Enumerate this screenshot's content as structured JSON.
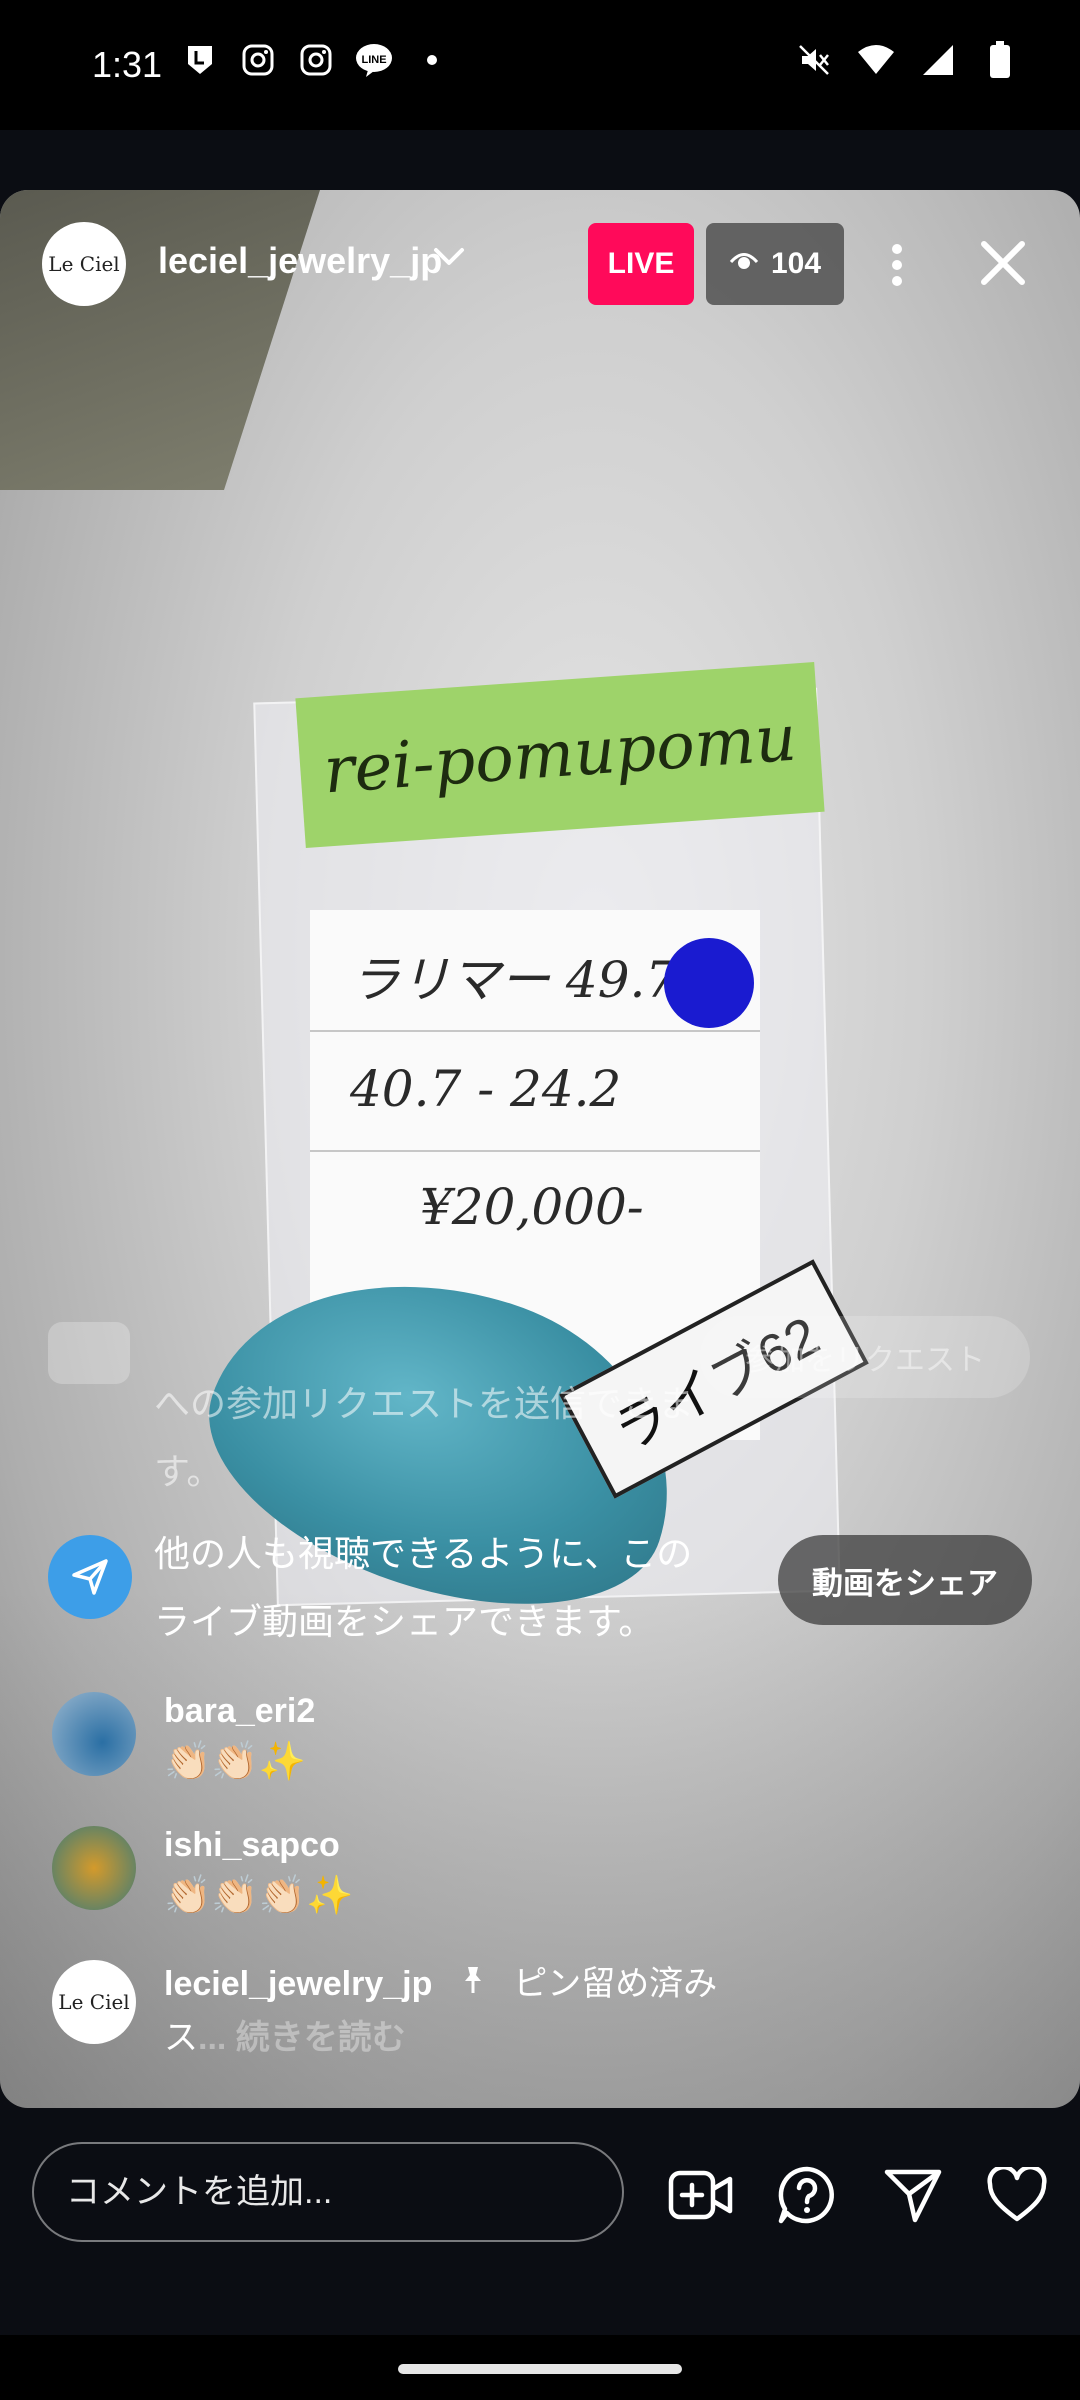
{
  "status_bar": {
    "time": "1:31",
    "app_icons": [
      "l-app-icon",
      "instagram-icon",
      "instagram-icon",
      "line-icon",
      "dot-icon"
    ],
    "system_icons": [
      "mute-icon",
      "wifi-icon",
      "signal-icon",
      "battery-icon"
    ]
  },
  "header": {
    "avatar_text": "Le Ciel",
    "username": "leciel_jewelry_jp",
    "live_label": "LIVE",
    "viewer_count": "104"
  },
  "video": {
    "sticky_note": "rei-pomupomu",
    "card_line1": "ラリマー 49.71",
    "card_line2": "40.7 - 24.2",
    "card_line3": "¥20,000-",
    "tag_text": "ライブ62"
  },
  "overlay": {
    "ghost_text": "への参加リクエストを送信できます。",
    "ghost_button": "参加をリクエスト",
    "share_text": "他の人も視聴できるように、このライブ動画をシェアできます。",
    "share_button": "動画をシェア"
  },
  "comments": [
    {
      "username": "bara_eri2",
      "text": "👏🏻👏🏻✨"
    },
    {
      "username": "ishi_sapco",
      "text": "👏🏻👏🏻👏🏻✨"
    }
  ],
  "pinned": {
    "avatar_text": "Le Ciel",
    "username": "leciel_jewelry_jp",
    "pin_label": "ピン留め済み",
    "continuation": "ス",
    "read_more": "... 続きを読む"
  },
  "bottom_bar": {
    "placeholder": "コメントを追加..."
  },
  "colors": {
    "live_badge": "#ff0a5a",
    "share_blue": "#3d9ee8",
    "background": "#0b0d13"
  }
}
